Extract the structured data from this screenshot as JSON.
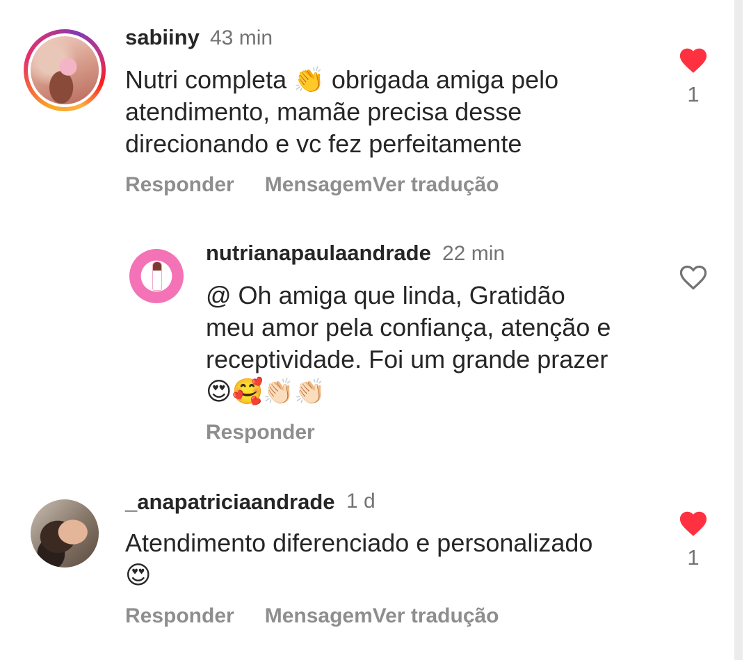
{
  "comments": [
    {
      "username": "sabiiny",
      "time": "43 min",
      "text": "Nutri completa 👏 obrigada amiga pelo\natendimento, mamãe precisa desse\ndirecionando e vc fez perfeitamente",
      "actions": {
        "reply": "Responder",
        "message": "Mensagem",
        "translate": "Ver tradução"
      },
      "liked": true,
      "like_count": "1"
    },
    {
      "username": "nutrianapaulaandrade",
      "time": "22 min",
      "text": "@ Oh amiga que linda, Gratidão\nmeu amor pela confiança, atenção e\nreceptividade. Foi um grande prazer\n😍🥰👏🏻👏🏻",
      "actions": {
        "reply": "Responder"
      },
      "liked": false
    },
    {
      "username": "_anapatriciaandrade",
      "time": "1 d",
      "text": "Atendimento diferenciado e personalizado\n😍",
      "actions": {
        "reply": "Responder",
        "message": "Mensagem",
        "translate": "Ver tradução"
      },
      "liked": true,
      "like_count": "1"
    }
  ],
  "colors": {
    "heart_liked": "#ff3040",
    "heart_outline": "#737373",
    "text": "#262626",
    "muted": "#737373",
    "action": "#8e8e8e"
  }
}
